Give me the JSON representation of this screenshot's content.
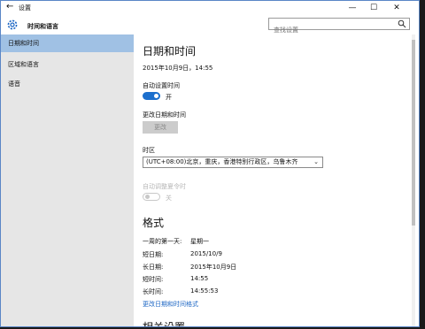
{
  "window": {
    "title": "设置",
    "minimize": "—",
    "maximize": "☐",
    "close": "✕"
  },
  "header": {
    "app_title": "时间和语言",
    "search_placeholder": "查找设置"
  },
  "sidebar": {
    "items": [
      {
        "label": "日期和时间",
        "active": true
      },
      {
        "label": "区域和语言",
        "active": false
      },
      {
        "label": "语音",
        "active": false
      }
    ]
  },
  "main": {
    "page_title": "日期和时间",
    "current_datetime": "2015年10月9日，14:55",
    "auto_time": {
      "label": "自动设置时间",
      "state": "开",
      "on": true
    },
    "change_datetime": {
      "label": "更改日期和时间",
      "button": "更改"
    },
    "timezone": {
      "label": "时区",
      "value": "(UTC+08:00)北京，重庆，香港特别行政区，乌鲁木齐"
    },
    "dst": {
      "label": "自动调整夏令时",
      "state": "关",
      "on": false
    },
    "format_title": "格式",
    "formats": [
      {
        "label": "一周的第一天:",
        "value": "星期一"
      },
      {
        "label": "短日期:",
        "value": "2015/10/9"
      },
      {
        "label": "长日期:",
        "value": "2015年10月9日"
      },
      {
        "label": "短时间:",
        "value": "14:55"
      },
      {
        "label": "长时间:",
        "value": "14:55:53"
      }
    ],
    "change_format_link": "更改日期和时间格式",
    "related_title": "相关设置"
  },
  "colors": {
    "accent": "#1c6fcd",
    "sidebar_active": "#a0c1e4",
    "sidebar_bg": "#e6e6e6"
  }
}
